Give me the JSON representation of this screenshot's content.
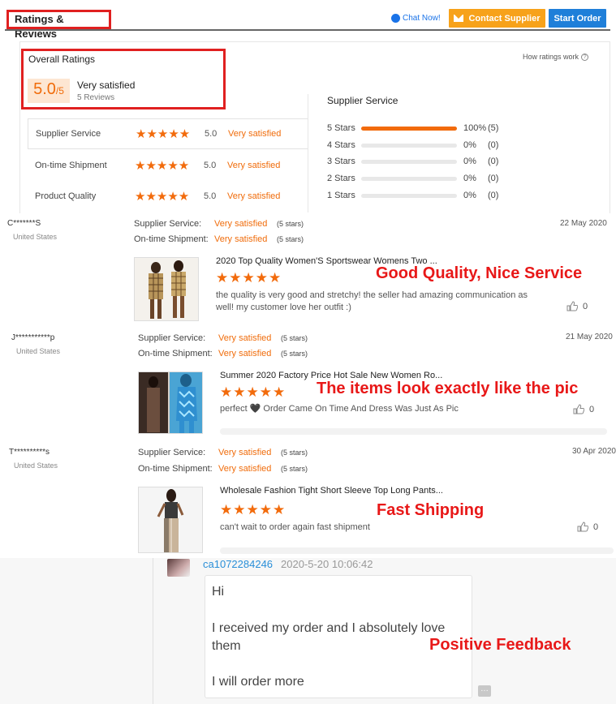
{
  "header": {
    "title": "Ratings & Reviews",
    "chat_now": "Chat Now!",
    "contact_supplier": "Contact Supplier",
    "start_order": "Start Order"
  },
  "overall": {
    "title": "Overall Ratings",
    "score": "5.0",
    "score_max": "/5",
    "label": "Very satisfied",
    "reviews_count": "5 Reviews",
    "how_ratings_work": "How ratings work",
    "criteria": [
      {
        "name": "Supplier Service",
        "score": "5.0",
        "label": "Very satisfied",
        "stars": "★★★★★"
      },
      {
        "name": "On-time Shipment",
        "score": "5.0",
        "label": "Very satisfied",
        "stars": "★★★★★"
      },
      {
        "name": "Product Quality",
        "score": "5.0",
        "label": "Very satisfied",
        "stars": "★★★★★"
      }
    ]
  },
  "distribution": {
    "title": "Supplier Service",
    "rows": [
      {
        "label": "5 Stars",
        "fraction": 1.0,
        "pct": "100%",
        "count": "(5)"
      },
      {
        "label": "4 Stars",
        "fraction": 0,
        "pct": "0%",
        "count": "(0)"
      },
      {
        "label": "3 Stars",
        "fraction": 0,
        "pct": "0%",
        "count": "(0)"
      },
      {
        "label": "2 Stars",
        "fraction": 0,
        "pct": "0%",
        "count": "(0)"
      },
      {
        "label": "1 Stars",
        "fraction": 0,
        "pct": "0%",
        "count": "(0)"
      }
    ]
  },
  "reviews": [
    {
      "name": "C*******S",
      "country": "United States",
      "supplier_service_key": "Supplier Service:",
      "supplier_service_val": "Very satisfied",
      "supplier_service_stars": "(5 stars)",
      "shipment_key": "On-time Shipment:",
      "shipment_val": "Very satisfied",
      "shipment_stars": "(5 stars)",
      "date": "22 May 2020",
      "product_title": "2020 Top Quality Women'S Sportswear Womens Two ...",
      "stars": "★★★★★",
      "text": "the quality is very good and stretchy! the seller had amazing communication as well! my customer love her outfit :)",
      "likes": "0",
      "overlay": "Good Quality, Nice Service"
    },
    {
      "name": "J***********p",
      "country": "United States",
      "supplier_service_key": "Supplier Service:",
      "supplier_service_val": "Very satisfied",
      "supplier_service_stars": "(5 stars)",
      "shipment_key": "On-time Shipment:",
      "shipment_val": "Very satisfied",
      "shipment_stars": "(5 stars)",
      "date": "21 May 2020",
      "product_title": "Summer 2020 Factory Price Hot Sale New Women Ro...",
      "stars": "★★★★★",
      "text": "perfect 🖤 Order Came On Time And Dress Was Just As Pic",
      "likes": "0",
      "overlay": "The items look exactly like the pic"
    },
    {
      "name": "T**********s",
      "country": "United States",
      "supplier_service_key": "Supplier Service:",
      "supplier_service_val": "Very satisfied",
      "supplier_service_stars": "(5 stars)",
      "shipment_key": "On-time Shipment:",
      "shipment_val": "Very satisfied",
      "shipment_stars": "(5 stars)",
      "date": "30 Apr 2020",
      "product_title": "Wholesale Fashion Tight Short Sleeve Top Long Pants...",
      "stars": "★★★★★",
      "text": "can't wait to order again fast shipment",
      "likes": "0",
      "overlay": "Fast Shipping"
    }
  ],
  "chat": {
    "username": "ca1072284246",
    "timestamp": "2020-5-20 10:06:42",
    "line1": "Hi",
    "line2": "I received my order and I absolutely love them",
    "line3": "I will order more",
    "overlay": "Positive Feedback"
  },
  "colors": {
    "accent": "#f06c0b",
    "contact": "#f7a21a",
    "start": "#1f7fd9",
    "overlay_red": "#e81818"
  }
}
